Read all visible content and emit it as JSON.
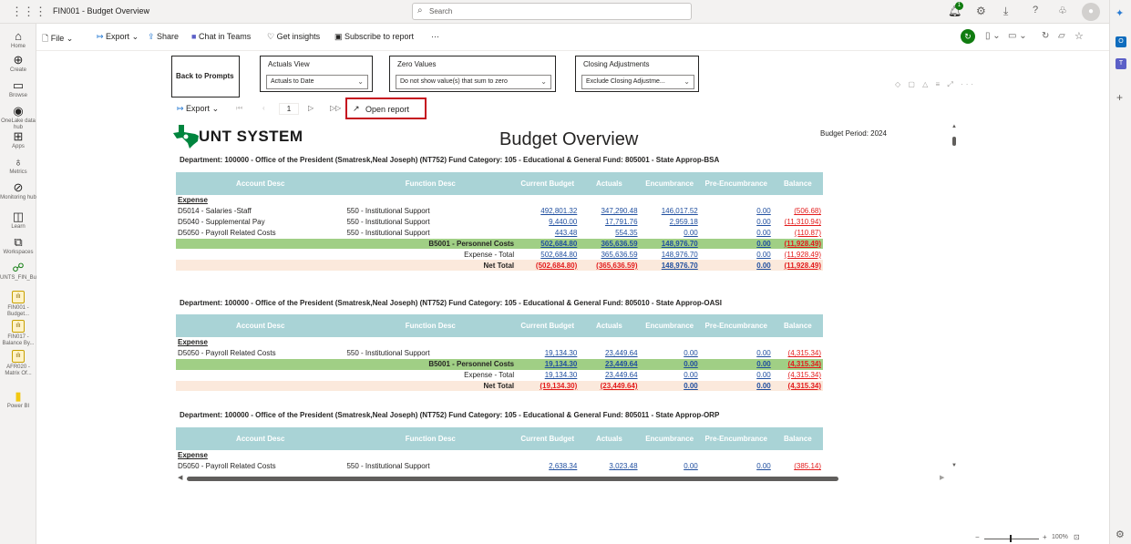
{
  "app": {
    "title": "FIN001 - Budget Overview",
    "search_placeholder": "Search",
    "notif_count": "1"
  },
  "leftnav": [
    {
      "icon": "home-icon",
      "glyph": "⌂",
      "label": "Home"
    },
    {
      "icon": "create-icon",
      "glyph": "⊕",
      "label": "Create"
    },
    {
      "icon": "browse-icon",
      "glyph": "▭",
      "label": "Browse"
    },
    {
      "icon": "onelake-icon",
      "glyph": "◉",
      "label": "OneLake data hub"
    },
    {
      "icon": "apps-icon",
      "glyph": "⊞",
      "label": "Apps"
    },
    {
      "icon": "metrics-icon",
      "glyph": "♁",
      "label": "Metrics"
    },
    {
      "icon": "monitoring-icon",
      "glyph": "⊘",
      "label": "Monitoring hub"
    },
    {
      "icon": "learn-icon",
      "glyph": "◫",
      "label": "Learn"
    },
    {
      "icon": "workspaces-icon",
      "glyph": "⧉",
      "label": "Workspaces"
    },
    {
      "icon": "workspace-icon",
      "glyph": "☍",
      "label": "UNTS_FIN_Budget_Reli..."
    },
    {
      "icon": "report-icon",
      "glyph": "ılı",
      "label": "FIN001 - Budget..."
    },
    {
      "icon": "report-icon",
      "glyph": "ılı",
      "label": "FIN017 - Balance By..."
    },
    {
      "icon": "report-icon",
      "glyph": "ılı",
      "label": "AFR020 - Matrix Of..."
    },
    {
      "icon": "powerbi-icon",
      "glyph": "▮",
      "label": "Power BI"
    }
  ],
  "cmdbar": {
    "file": "File",
    "export": "Export",
    "share": "Share",
    "teams": "Chat in Teams",
    "insights": "Get insights",
    "subscribe": "Subscribe to report",
    "more": "···"
  },
  "prompts": {
    "back": "Back to Prompts",
    "actuals_view_label": "Actuals View",
    "actuals_view_value": "Actuals to Date",
    "zero_values_label": "Zero Values",
    "zero_values_value": "Do not show value(s) that sum to zero",
    "closing_label": "Closing Adjustments",
    "closing_value": "Exclude Closing Adjustme..."
  },
  "report_toolbar": {
    "export": "Export",
    "page": "1",
    "open_report": "Open report"
  },
  "report": {
    "logo_text": "UNT SYSTEM",
    "title": "Budget Overview",
    "period": "Budget Period: 2024",
    "headers": [
      "Account Desc",
      "Function Desc",
      "Current Budget",
      "Actuals",
      "Encumbrance",
      "Pre-Encumbrance",
      "Balance"
    ],
    "section1": {
      "dept": "Department: 100000 - Office of the President (Smatresk,Neal Joseph) (NT752)  Fund Category: 105 - Educational & General Fund: 805001 - State Approp-BSA",
      "expense": "Expense",
      "rows": [
        [
          "D5014 - Salaries -Staff",
          "550 - Institutional Support",
          "492,801.32",
          "347,290.48",
          "146,017.52",
          "0.00",
          "(506.68)"
        ],
        [
          "D5040 - Supplemental Pay",
          "550 - Institutional Support",
          "9,440.00",
          "17,791.76",
          "2,959.18",
          "0.00",
          "(11,310.94)"
        ],
        [
          "D5050 - Payroll Related Costs",
          "550 - Institutional Support",
          "443.48",
          "554.35",
          "0.00",
          "0.00",
          "(110.87)"
        ]
      ],
      "subtotal": [
        "B5001 - Personnel Costs",
        "502,684.80",
        "365,636.59",
        "148,976.70",
        "0.00",
        "(11,928.49)"
      ],
      "exptotal": [
        "Expense - Total",
        "502,684.80",
        "365,636.59",
        "148,976.70",
        "0.00",
        "(11,928.49)"
      ],
      "nettotal": [
        "Net Total",
        "(502,684.80)",
        "(365,636.59)",
        "148,976.70",
        "0.00",
        "(11,928.49)"
      ]
    },
    "section2": {
      "dept": "Department: 100000 - Office of the President (Smatresk,Neal Joseph) (NT752)  Fund Category: 105 - Educational & General Fund: 805010 - State Approp-OASI",
      "expense": "Expense",
      "rows": [
        [
          "D5050 - Payroll Related Costs",
          "550 - Institutional Support",
          "19,134.30",
          "23,449.64",
          "0.00",
          "0.00",
          "(4,315.34)"
        ]
      ],
      "subtotal": [
        "B5001 - Personnel Costs",
        "19,134.30",
        "23,449.64",
        "0.00",
        "0.00",
        "(4,315.34)"
      ],
      "exptotal": [
        "Expense - Total",
        "19,134.30",
        "23,449.64",
        "0.00",
        "0.00",
        "(4,315.34)"
      ],
      "nettotal": [
        "Net Total",
        "(19,134.30)",
        "(23,449.64)",
        "0.00",
        "0.00",
        "(4,315.34)"
      ]
    },
    "section3": {
      "dept": "Department: 100000 - Office of the President (Smatresk,Neal Joseph) (NT752)  Fund Category: 105 - Educational & General Fund: 805011 - State Approp-ORP",
      "expense": "Expense",
      "rows": [
        [
          "D5050 - Payroll Related Costs",
          "550 - Institutional Support",
          "2,638.34",
          "3,023.48",
          "0.00",
          "0.00",
          "(385.14)"
        ]
      ]
    }
  },
  "status": {
    "zoom": "100%"
  },
  "colors": {
    "accent": "#c50f1f",
    "header_teal": "#a9d3d6",
    "subtotal_green": "#a0cf85",
    "net_peach": "#fbe9dc",
    "link_blue": "#1f4e9f",
    "neg_red": "#e31b1b"
  }
}
